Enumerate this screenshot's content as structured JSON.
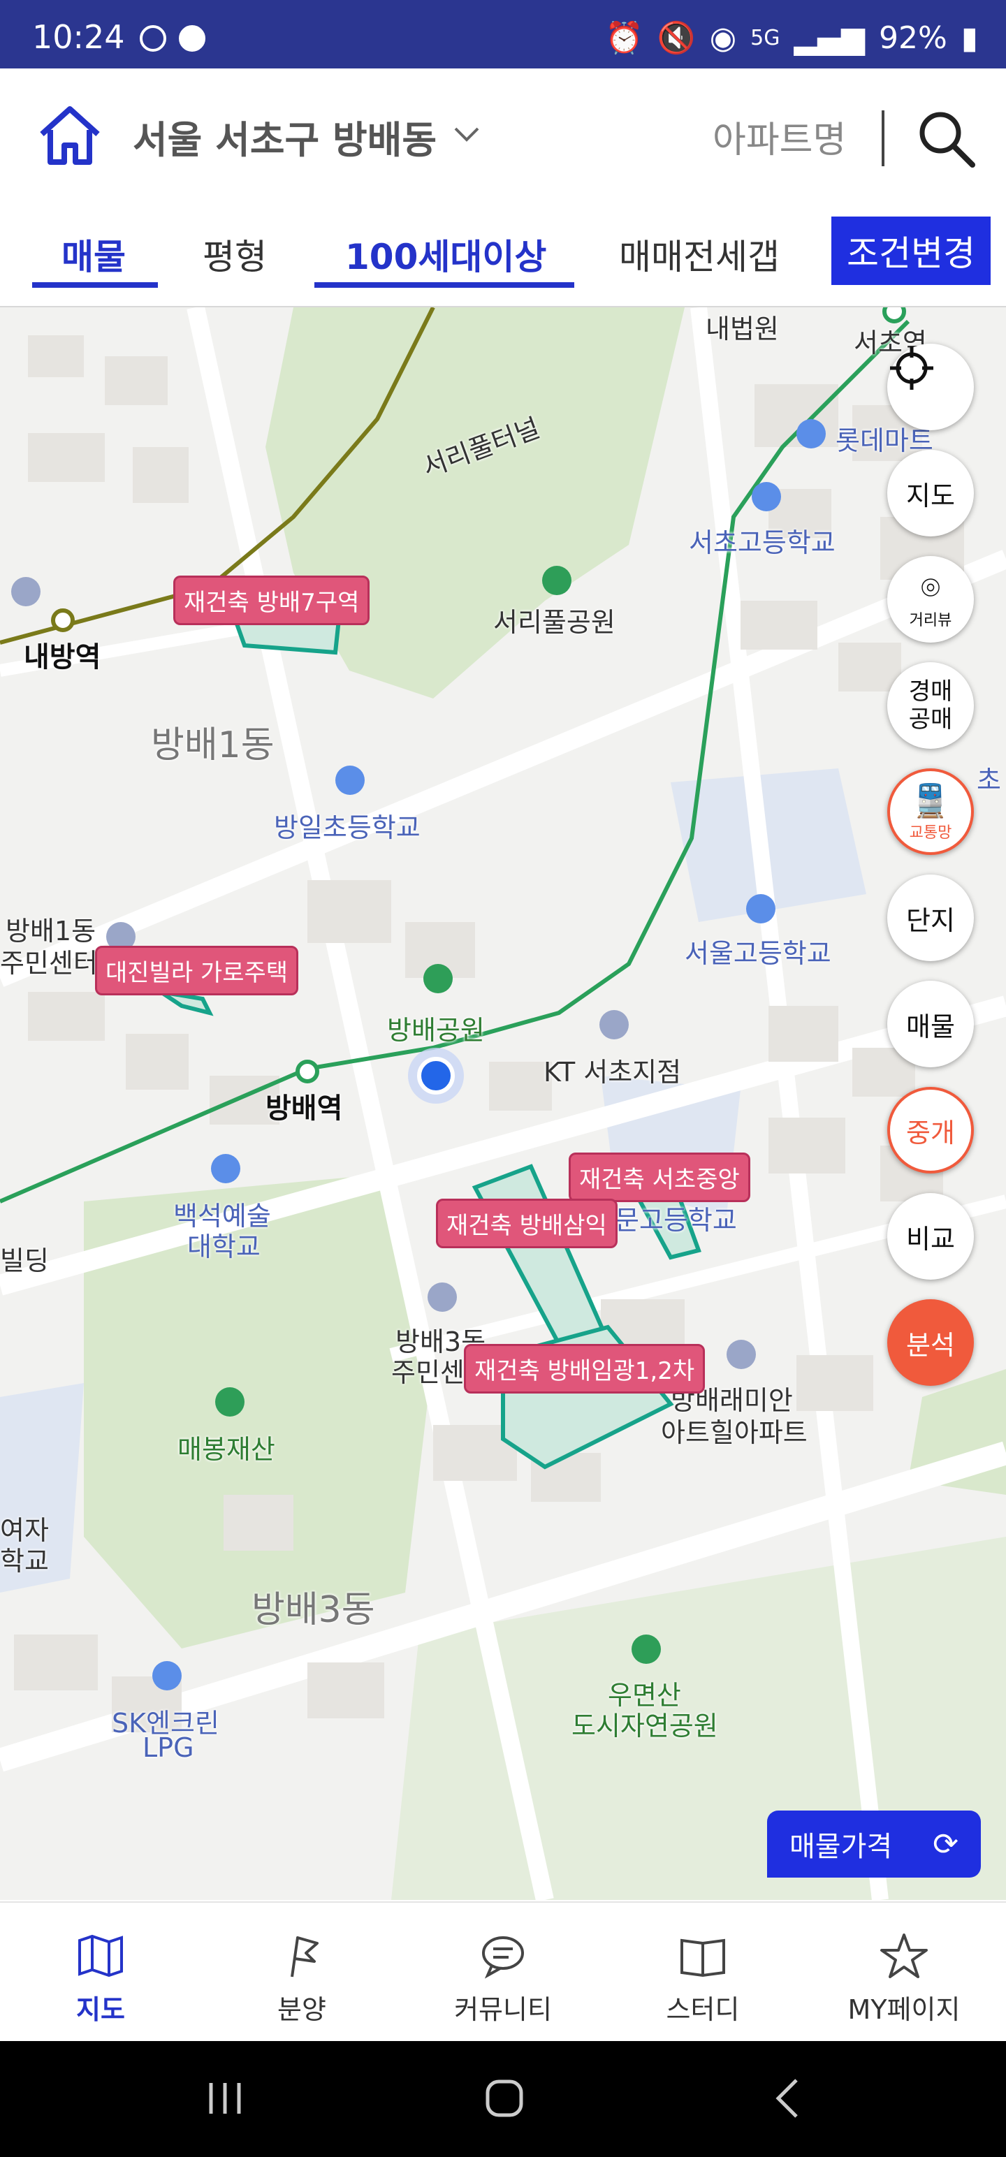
{
  "status_bar": {
    "time": "10:24",
    "battery": "92%",
    "network": "5G"
  },
  "header": {
    "location": "서울 서초구 방배동",
    "apartment_placeholder": "아파트명"
  },
  "filters": {
    "tabs": [
      "매물",
      "평형",
      "100세대이상",
      "매매전세갭"
    ],
    "condition_button": "조건변경"
  },
  "map": {
    "labels": [
      {
        "text": "내방역"
      },
      {
        "text": "서리풀터널"
      },
      {
        "text": "서리풀공원"
      },
      {
        "text": "롯데마트"
      },
      {
        "text": "서초고등학교"
      },
      {
        "text": "방배1동"
      },
      {
        "text": "방일초등학교"
      },
      {
        "text": "방배1동"
      },
      {
        "text": "주민센터"
      },
      {
        "text": "서울고등학교"
      },
      {
        "text": "방배공원"
      },
      {
        "text": "KT 서초지점"
      },
      {
        "text": "방배역"
      },
      {
        "text": "백석예술"
      },
      {
        "text": "대학교"
      },
      {
        "text": "빌딩"
      },
      {
        "text": "문고등학교"
      },
      {
        "text": "방배3동"
      },
      {
        "text": "주민센터"
      },
      {
        "text": "방배래미안"
      },
      {
        "text": "아트힐아파트"
      },
      {
        "text": "매봉재산"
      },
      {
        "text": "여자"
      },
      {
        "text": "학교"
      },
      {
        "text": "방배3동"
      },
      {
        "text": "우면산"
      },
      {
        "text": "도시자연공원"
      },
      {
        "text": "SK엔크린"
      },
      {
        "text": "LPG"
      },
      {
        "text": "내법원"
      },
      {
        "text": "서초역"
      },
      {
        "text": "초"
      }
    ],
    "tags": [
      {
        "text": "재건축 방배7구역"
      },
      {
        "text": "대진빌라 가로주택"
      },
      {
        "text": "재건축 서초중앙"
      },
      {
        "text": "재건축 방배삼익"
      },
      {
        "text": "재건축 방배임광1,2차"
      }
    ],
    "side_buttons": [
      {
        "label": "",
        "icon": "crosshair-icon"
      },
      {
        "label": "지도"
      },
      {
        "label": "거리뷰",
        "icon": "location-pin-icon"
      },
      {
        "label": "경매\n공매"
      },
      {
        "label": "교통망",
        "icon": "train-icon"
      },
      {
        "label": "단지"
      },
      {
        "label": "매물"
      },
      {
        "label": "중개"
      },
      {
        "label": "비교"
      },
      {
        "label": "분석"
      }
    ],
    "price_button": "매물가격"
  },
  "bottom_nav": [
    {
      "label": "지도",
      "icon": "map-icon",
      "active": true
    },
    {
      "label": "분양",
      "icon": "flag-icon",
      "active": false
    },
    {
      "label": "커뮤니티",
      "icon": "chat-icon",
      "active": false
    },
    {
      "label": "스터디",
      "icon": "book-icon",
      "active": false
    },
    {
      "label": "MY페이지",
      "icon": "star-icon",
      "active": false
    }
  ],
  "colors": {
    "brand_blue": "#1f2fe0",
    "status_bar": "#2b3690",
    "tag_pink": "#e0567a",
    "accent_orange": "#f05a3c"
  }
}
